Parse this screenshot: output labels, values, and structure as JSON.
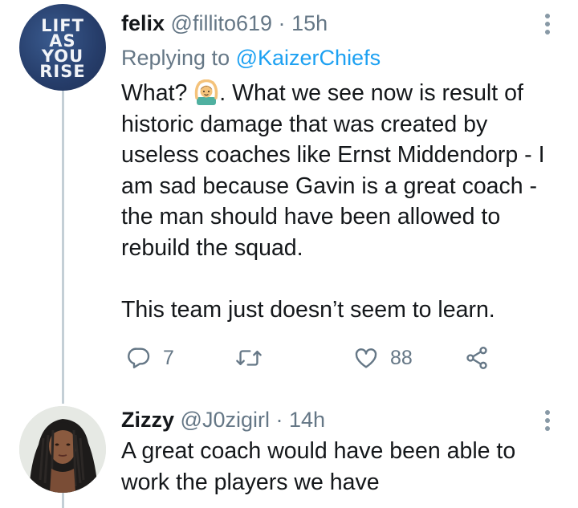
{
  "tweets": [
    {
      "avatar_text": [
        "LIFT",
        "AS",
        "YOU",
        "RISE"
      ],
      "display_name": "felix",
      "handle": "@fillito619",
      "separator": "·",
      "time": "15h",
      "reply_prefix": "Replying to",
      "reply_handle": "@KaizerChiefs",
      "text_start": "What?",
      "emoji": "man-gesturing-ok",
      "text_rest": ". What we see now is result of historic damage that was created by useless coaches like Ernst Middendorp - I am sad because Gavin is a great coach - the man should have been allowed to rebuild the squad.",
      "text_second_paragraph": "This team just doesn’t seem to learn.",
      "actions": {
        "reply_icon": "reply-icon",
        "reply_count": "7",
        "retweet_icon": "retweet-icon",
        "like_icon": "heart-icon",
        "like_count": "88",
        "share_icon": "share-icon"
      }
    },
    {
      "display_name": "Zizzy",
      "handle": "@J0zigirl",
      "separator": "·",
      "time": "14h",
      "text": "A great coach would have been able to work the players we have"
    }
  ],
  "colors": {
    "text": "#14171a",
    "secondary": "#657786",
    "link": "#1da1f2",
    "thread_line": "#c4cfd6",
    "lift_avatar_bg": "#263d6a"
  }
}
